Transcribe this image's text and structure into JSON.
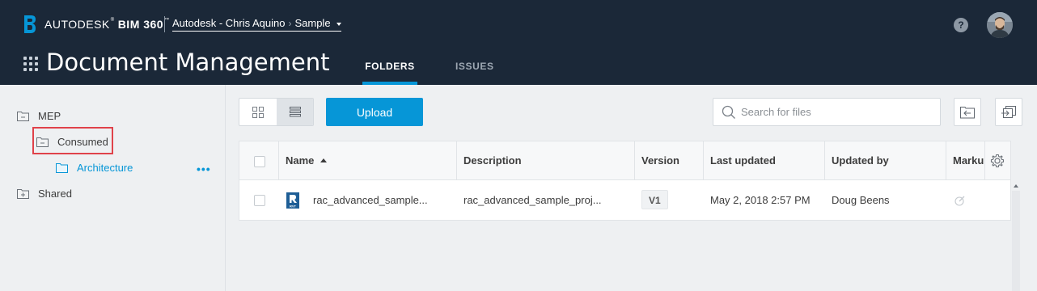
{
  "header": {
    "logo_brand": "AUTODESK",
    "logo_reg": "®",
    "logo_product": "BIM 360",
    "logo_tm": "™",
    "account": "Autodesk - Chris Aquino",
    "project": "Sample",
    "help_label": "?",
    "avatar_icon": "user-avatar"
  },
  "app": {
    "title": "Document Management",
    "tabs": [
      {
        "label": "FOLDERS",
        "active": true
      },
      {
        "label": "ISSUES",
        "active": false
      }
    ]
  },
  "sidebar": {
    "items": [
      {
        "label": "MEP",
        "icon": "folder-collapse-icon",
        "level": 0,
        "expanded": true
      },
      {
        "label": "Consumed",
        "icon": "folder-collapse-icon",
        "level": 1,
        "expanded": true,
        "highlighted": true
      },
      {
        "label": "Architecture",
        "icon": "folder-icon",
        "level": 2,
        "selected": true
      },
      {
        "label": "Shared",
        "icon": "folder-expand-icon",
        "level": 0,
        "expanded": false
      }
    ],
    "more_label": "•••"
  },
  "toolbar": {
    "upload_label": "Upload",
    "search_placeholder": "Search for files"
  },
  "table": {
    "columns": [
      "Name",
      "Description",
      "Version",
      "Last updated",
      "Updated by",
      "Marku"
    ],
    "sort_column": "Name",
    "sort_dir": "asc",
    "rows": [
      {
        "name": "rac_advanced_sample...",
        "file_icon": "rvt-file-icon",
        "file_type_label": "RVT",
        "description": "rac_advanced_sample_proj...",
        "version": "V1",
        "last_updated": "May 2, 2018 2:57 PM",
        "updated_by": "Doug Beens",
        "markup_icon": "markup-icon"
      }
    ]
  },
  "colors": {
    "header_bg": "#1b2838",
    "accent": "#0696d7",
    "highlight": "#e0424a"
  }
}
